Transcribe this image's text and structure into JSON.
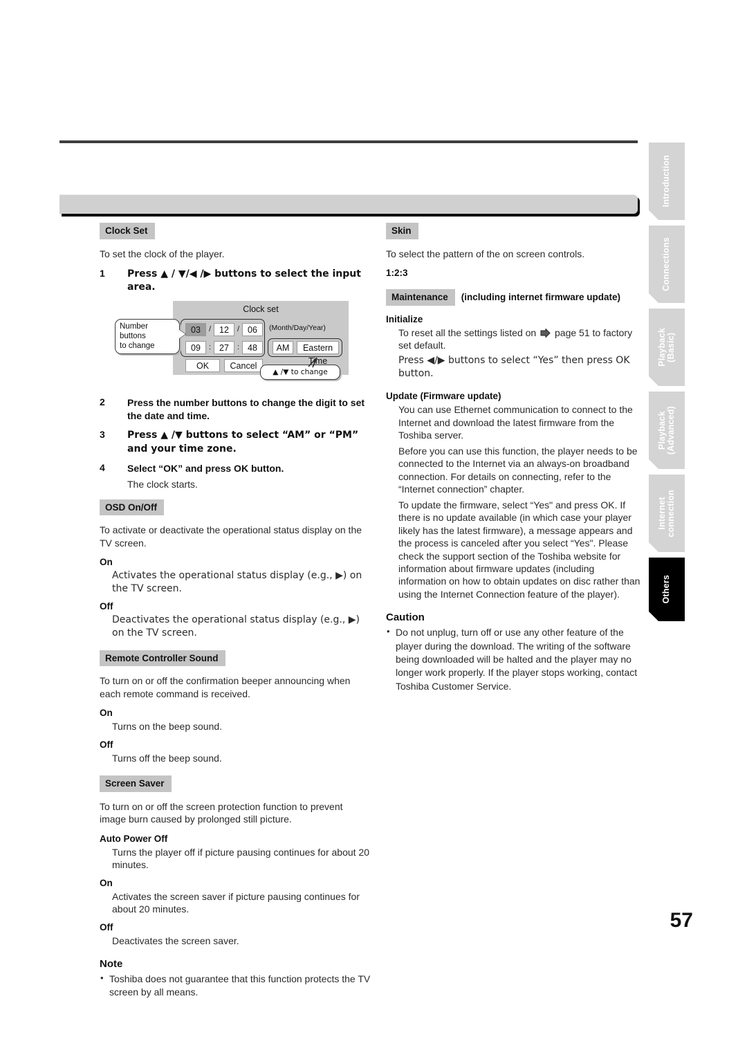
{
  "page": {
    "number": "57",
    "header_bar_title": ""
  },
  "side_tabs": [
    {
      "label": "Introduction",
      "active": false
    },
    {
      "label": "Connections",
      "active": false
    },
    {
      "label": "Playback\n(Basic)",
      "active": false
    },
    {
      "label": "Playback\n(Advanced)",
      "active": false
    },
    {
      "label": "Internet\nconnection",
      "active": false
    },
    {
      "label": "Others",
      "active": true
    }
  ],
  "left_column": {
    "clock_set": {
      "heading": "Clock Set",
      "intro": "To set the clock of the player.",
      "steps": [
        {
          "num": "1",
          "text": "Press ▲ / ▼/◀ /▶ buttons to select the input area."
        },
        {
          "num": "2",
          "text": "Press the number buttons to change the digit to set the date and time."
        },
        {
          "num": "3",
          "text": "Press ▲ /▼ buttons to select “AM” or “PM” and your time zone."
        },
        {
          "num": "4",
          "text": "Select “OK” and press OK button."
        }
      ],
      "step4_note": "The clock starts.",
      "figure": {
        "title": "Clock set",
        "date_fields": [
          "03",
          "12",
          "06"
        ],
        "date_separators": [
          "/",
          "/"
        ],
        "date_format_label": "(Month/Day/Year)",
        "time_fields": [
          "09",
          "27",
          "48"
        ],
        "time_separators": [
          ":",
          ":"
        ],
        "ampm": "AM",
        "timezone": "Eastern Time",
        "ok_button": "OK",
        "cancel_button": "Cancel",
        "callout_left": "Number buttons\nto change",
        "callout_bottom": "▲ /▼ to change",
        "selected_field": "03"
      }
    },
    "osd": {
      "heading": "OSD On/Off",
      "intro": "To activate or deactivate the operational status display on the TV screen.",
      "options": [
        {
          "label": "On",
          "text": "Activates the operational status display (e.g., ▶) on the TV screen."
        },
        {
          "label": "Off",
          "text": "Deactivates the operational status display (e.g., ▶) on the TV screen."
        }
      ]
    },
    "remote_sound": {
      "heading": "Remote Controller Sound",
      "intro": "To turn on or off the confirmation beeper announcing when each remote command is received.",
      "options": [
        {
          "label": "On",
          "text": "Turns on the beep sound."
        },
        {
          "label": "Off",
          "text": "Turns off the beep sound."
        }
      ]
    },
    "screen_saver": {
      "heading": "Screen Saver",
      "intro": "To turn on or off the screen protection function to prevent image burn caused by prolonged still picture.",
      "options": [
        {
          "label": "Auto Power Off",
          "text": "Turns the player off if picture pausing continues for about 20 minutes."
        },
        {
          "label": "On",
          "text": "Activates the screen saver if picture pausing continues for about 20 minutes."
        },
        {
          "label": "Off",
          "text": "Deactivates the screen saver."
        }
      ]
    },
    "note": {
      "title": "Note",
      "bullets": [
        "Toshiba does not guarantee that this function protects the TV screen by all means."
      ]
    }
  },
  "right_column": {
    "skin": {
      "heading": "Skin",
      "intro": "To select the pattern of the on screen controls.",
      "option": "1:2:3"
    },
    "maintenance": {
      "heading": "Maintenance",
      "heading_suffix": "(including internet firmware update)",
      "initialize": {
        "title": "Initialize",
        "text_before_icon": "To reset all the settings listed on",
        "text_after_icon": "page 51 to factory set default.",
        "press_line": "Press ◀/▶ buttons to select “Yes” then press OK button."
      },
      "update": {
        "title": "Update (Firmware update)",
        "paragraphs": [
          "You can use Ethernet communication to connect to the Internet and download the latest firmware from the Toshiba server.",
          "Before you can use this function, the player needs to be connected to the Internet via an always-on broadband connection. For details on connecting, refer to the “Internet connection” chapter.",
          "To update the firmware, select “Yes\" and press OK. If there is no update available (in which case your player likely has the latest firmware), a message appears and the process is canceled after you select “Yes\". Please check the support section of the Toshiba website for information about firmware updates (including information on how to obtain updates on disc rather than using the Internet Connection feature of the player)."
        ]
      }
    },
    "caution": {
      "title": "Caution",
      "bullets": [
        "Do not unplug, turn off or use any other feature of the player during the download. The writing of the software being downloaded will be halted and the player may no longer work properly. If the player stops working, contact Toshiba Customer Service."
      ]
    }
  }
}
